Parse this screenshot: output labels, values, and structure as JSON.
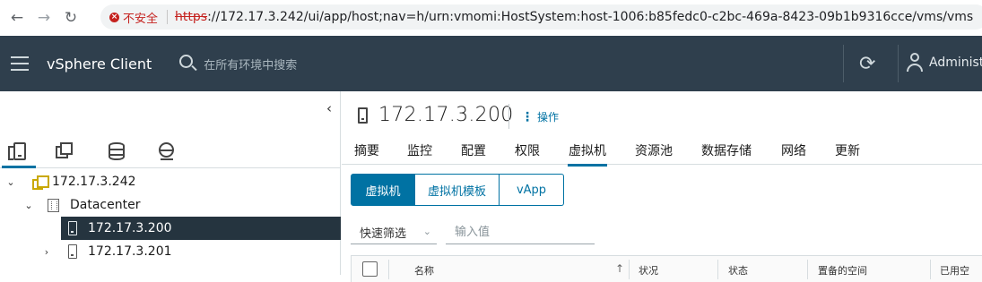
{
  "browser": {
    "back_icon": "arrow-left-icon",
    "forward_icon": "arrow-right-icon",
    "reload_icon": "reload-icon",
    "security_label": "不安全",
    "url_scheme": "https",
    "url_rest": "://172.17.3.242/ui/app/host;nav=h/urn:vmomi:HostSystem:host-1006:b85fedc0-c2bc-469a-8423-09b1b9316cce/vms/vms"
  },
  "header": {
    "app_title": "vSphere Client",
    "search_placeholder": "在所有环境中搜索",
    "user_label": "Administ"
  },
  "navigator": {
    "collapse_glyph": "‹",
    "tabs": [
      {
        "name": "hosts-and-clusters",
        "icon": "host-icon"
      },
      {
        "name": "vms-and-templates",
        "icon": "vm-icon"
      },
      {
        "name": "storage",
        "icon": "database-icon"
      },
      {
        "name": "networking",
        "icon": "network-icon"
      }
    ],
    "tree": [
      {
        "label": "172.17.3.242",
        "toggle": "⌄",
        "icon": "vcenter-icon",
        "level": 0
      },
      {
        "label": "Datacenter",
        "toggle": "⌄",
        "icon": "datacenter-icon",
        "level": 1
      },
      {
        "label": "172.17.3.200",
        "toggle": "",
        "icon": "host-icon",
        "level": 2,
        "selected": true
      },
      {
        "label": "172.17.3.201",
        "toggle": "›",
        "icon": "host-icon",
        "level": 2
      }
    ]
  },
  "main": {
    "object_name": "172.17.3.200",
    "actions_label": "操作",
    "tabs": [
      "摘要",
      "监控",
      "配置",
      "权限",
      "虚拟机",
      "资源池",
      "数据存储",
      "网络",
      "更新"
    ],
    "active_tab": "虚拟机",
    "segments": [
      "虚拟机",
      "虚拟机模板",
      "vApp"
    ],
    "quick_filter_label": "快速筛选",
    "filter_placeholder": "输入值",
    "columns": [
      "名称",
      "状况",
      "状态",
      "置备的空间",
      "已用空"
    ]
  },
  "colors": {
    "header_bg": "#2f3f4d",
    "accent": "#0072a3",
    "selected_row": "#25343f",
    "insecure": "#c5221f"
  }
}
